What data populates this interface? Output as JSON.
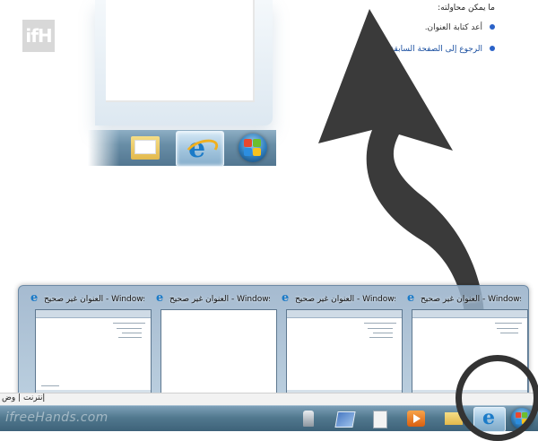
{
  "logo": {
    "text": "ifH"
  },
  "watermark": {
    "text": "ifreeHands.com"
  },
  "ie_error": {
    "heading": "ما يمكن محاولته:",
    "items": [
      {
        "label": "أعد كتابة العنوان."
      },
      {
        "label": "الرجوع إلى الصفحة السابقة."
      }
    ]
  },
  "zoom_inset": {
    "buttons": [
      {
        "icon": "folder-icon"
      },
      {
        "icon": "internet-explorer-icon",
        "active": true
      },
      {
        "icon": "windows-start-orb-icon"
      }
    ]
  },
  "thumbnails": [
    {
      "title": "العنوان غير صحيح - Windows Inter..."
    },
    {
      "title": "العنوان غير صحيح - Windows Inter..."
    },
    {
      "title": "العنوان غير صحيح - Windows Inter..."
    },
    {
      "title": "العنوان غير صحيح - Windows Inter..."
    }
  ],
  "status_bar": {
    "text": "إنترنت | وض"
  },
  "taskbar": {
    "buttons": [
      {
        "icon": "media-center-icon"
      },
      {
        "icon": "document-icon"
      },
      {
        "icon": "files-icon"
      },
      {
        "icon": "media-player-icon"
      },
      {
        "icon": "folder-icon"
      },
      {
        "icon": "internet-explorer-icon",
        "active": true
      },
      {
        "icon": "windows-start-orb-icon"
      }
    ]
  },
  "colors": {
    "arrow": "#3a3a3a",
    "taskbar_top": "#7da0b8",
    "taskbar_bottom": "#3d6279",
    "link": "#1a4fa0"
  }
}
